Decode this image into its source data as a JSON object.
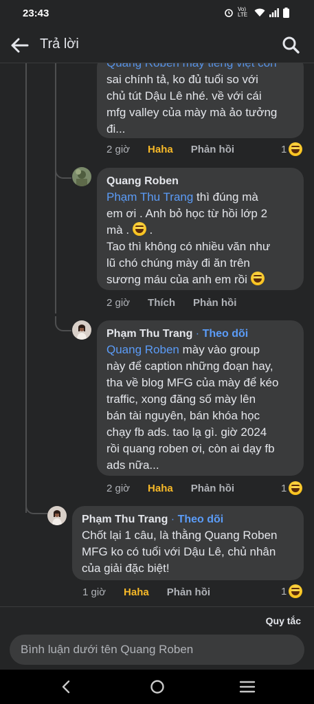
{
  "status_bar": {
    "time": "23:43",
    "network_label": "Vo) LTE"
  },
  "app_bar": {
    "title": "Trả lời"
  },
  "comments": [
    {
      "partial_top_line": "Quang Roben mày tiếng việt còn",
      "lines": [
        "sai chính tả, ko đủ tuổi so với",
        "chủ tút Dậu Lê nhé. về với cái",
        "mfg valley của mày mà ảo tưởng",
        "đi..."
      ],
      "time": "2 giờ",
      "reaction_label": "Haha",
      "reply_label": "Phản hồi",
      "reaction_count": "1"
    },
    {
      "author": "Quang Roben",
      "mention": "Phạm Thu Trang",
      "text_after_mention": " thì đúng mà",
      "lines": [
        "em ơi . Anh bỏ học từ hồi lớp 2",
        "mà . ",
        "Tao thì không có nhiều văn như",
        "lũ chó chúng mày đi ăn trên",
        "sương máu của anh em rồi "
      ],
      "time": "2 giờ",
      "reaction_label": "Thích",
      "reply_label": "Phản hồi"
    },
    {
      "author": "Phạm Thu Trang",
      "separator": " · ",
      "follow_label": "Theo dõi",
      "mention": "Quang Roben",
      "text_after_mention": " mày vào group",
      "lines": [
        "này để caption những đoạn hay,",
        "tha về blog MFG của mày để kéo",
        "traffic, xong đăng số mày lên",
        "bán tài nguyên, bán khóa học",
        "chạy fb ads. tao lạ gì. giờ 2024",
        "rồi quang roben ơi, còn ai dạy fb",
        "ads nữa..."
      ],
      "time": "2 giờ",
      "reaction_label": "Haha",
      "reply_label": "Phản hồi",
      "reaction_count": "1"
    },
    {
      "author": "Phạm Thu Trang",
      "separator": " · ",
      "follow_label": "Theo dõi",
      "lines": [
        "Chốt lại 1 câu, là thằng Quang Roben",
        "MFG ko có tuổi với Dậu Lê, chủ nhân",
        "của giải đặc biệt!"
      ],
      "time": "1 giờ",
      "reaction_label": "Haha",
      "reply_label": "Phản hồi",
      "reaction_count": "1"
    }
  ],
  "footer": {
    "rules_label": "Quy tắc",
    "input_placeholder": "Bình luận dưới tên Quang Roben"
  },
  "colors": {
    "background": "#242526",
    "bubble": "#3a3b3c",
    "mention": "#5b9cf8",
    "haha": "#f7b928",
    "secondary_text": "#b0b3b8"
  },
  "icons": [
    "back-arrow-icon",
    "search-icon",
    "haha-emoji-icon",
    "laugh-cry-emoji-icon",
    "nav-back-icon",
    "nav-home-icon",
    "nav-recents-icon",
    "alarm-icon",
    "wifi-icon",
    "signal-icon",
    "battery-icon"
  ]
}
